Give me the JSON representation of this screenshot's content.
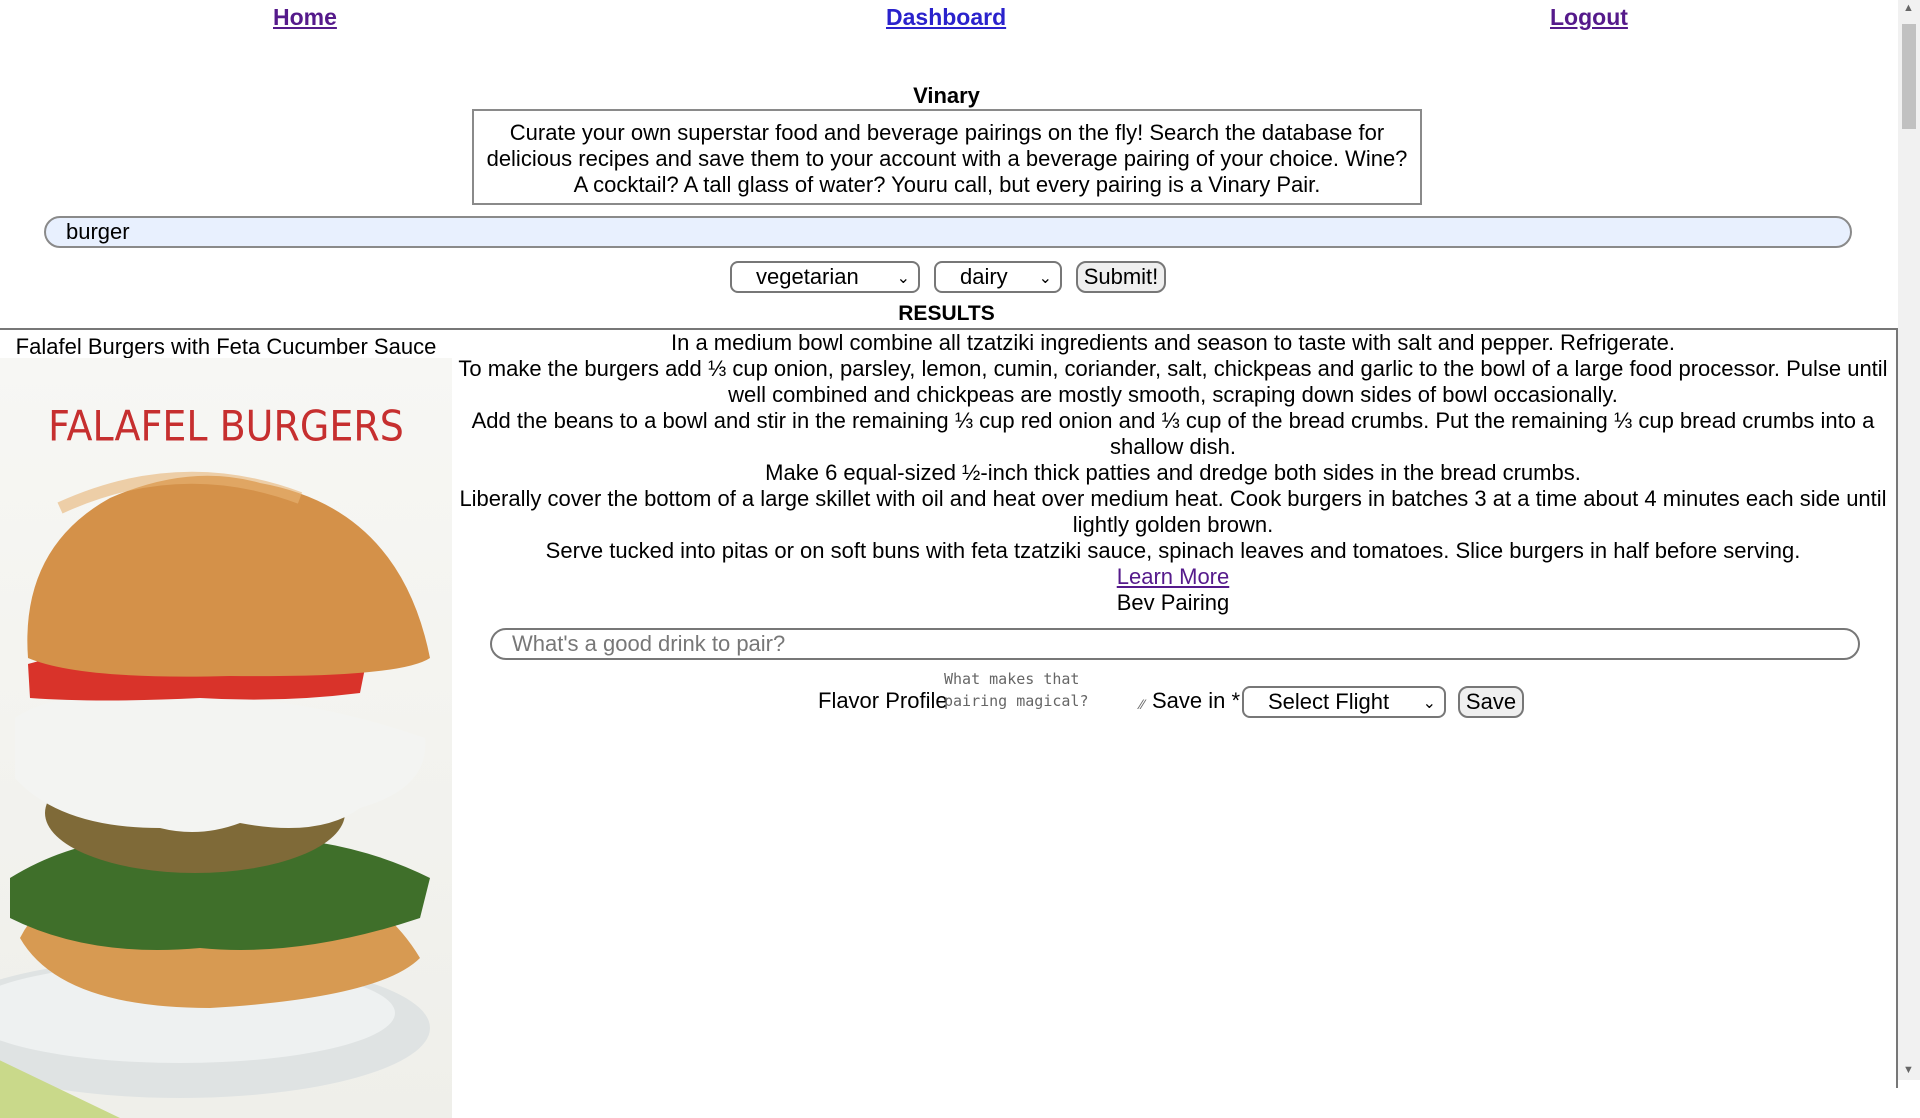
{
  "nav": {
    "home": "Home",
    "dashboard": "Dashboard",
    "logout": "Logout"
  },
  "app": {
    "title": "Vinary",
    "description": "Curate your own superstar food and beverage pairings on the fly! Search the database for delicious recipes and save them to your account with a beverage pairing of your choice. Wine? A cocktail? A tall glass of water? Youru call, but every pairing is a Vinary Pair."
  },
  "search": {
    "value": "burger",
    "diet_selected": "vegetarian",
    "intolerance_selected": "dairy",
    "submit_label": "Submit!"
  },
  "results": {
    "heading": "RESULTS",
    "recipe": {
      "title": "Falafel Burgers with Feta Cucumber Sauce",
      "image_text": "FALAFEL BURGERS",
      "instructions": [
        "In a medium bowl combine all tzatziki ingredients and season to taste with salt and pepper. Refrigerate.",
        "To make the burgers add ⅓ cup onion, parsley, lemon, cumin, coriander, salt, chickpeas and garlic to the bowl of a large food processor. Pulse until well combined and chickpeas are mostly smooth, scraping down sides of bowl occasionally.",
        "Add the beans to a bowl and stir in the remaining ⅓ cup red onion and ⅓ cup of the bread crumbs. Put the remaining ⅓ cup bread crumbs into a shallow dish.",
        "Make 6 equal-sized ½-inch thick patties and dredge both sides in the bread crumbs.",
        "Liberally cover the bottom of a large skillet with oil and heat over medium heat. Cook burgers in batches 3 at a time about 4 minutes each side until lightly golden brown.",
        "Serve tucked into pitas or on soft buns with feta tzatziki sauce, spinach leaves and tomatoes. Slice burgers in half before serving."
      ],
      "learn_more": "Learn More",
      "bev_pairing_label": "Bev Pairing",
      "pair_placeholder": "What's a good drink to pair?",
      "flavor_label": "Flavor Profile",
      "flavor_placeholder": "What makes that pairing magical?",
      "save_in_label": "Save in *",
      "flight_selected": "Select Flight",
      "save_label": "Save"
    }
  },
  "icons": {
    "dropdown": "chevron-down-icon",
    "resize": "resize-grip-icon"
  },
  "colors": {
    "visited_link": "#551a8b",
    "link": "#2a22cc",
    "search_bg": "#e8f0fe",
    "photo_title": "#c62f2f"
  }
}
